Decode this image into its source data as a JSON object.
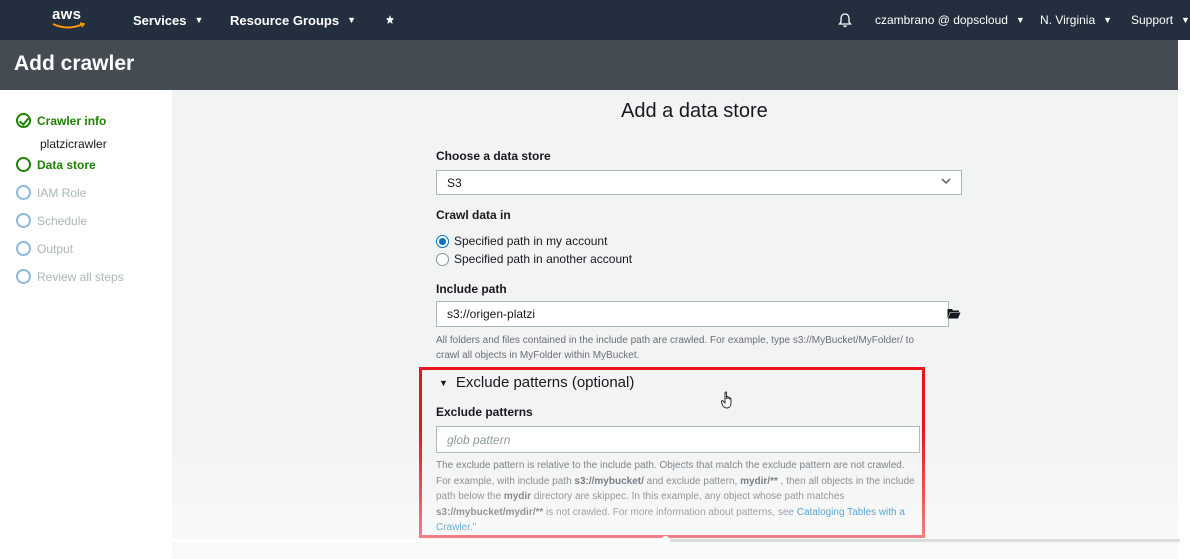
{
  "topnav": {
    "logo": "aws",
    "services": "Services",
    "resource_groups": "Resource Groups",
    "user": "czambrano @ dopscloud",
    "region": "N. Virginia",
    "support": "Support"
  },
  "header": {
    "title": "Add crawler"
  },
  "sidebar": {
    "steps": [
      {
        "label": "Crawler info",
        "state": "done"
      },
      {
        "label": "Data store",
        "state": "active"
      },
      {
        "label": "IAM Role",
        "state": "pending"
      },
      {
        "label": "Schedule",
        "state": "pending"
      },
      {
        "label": "Output",
        "state": "pending"
      },
      {
        "label": "Review all steps",
        "state": "pending"
      }
    ],
    "crawler_name": "platzicrawler"
  },
  "main": {
    "title": "Add a data store",
    "choose_label": "Choose a data store",
    "data_store_value": "S3",
    "crawl_label": "Crawl data in",
    "radio_options": [
      "Specified path in my account",
      "Specified path in another account"
    ],
    "radio_selected_index": 0,
    "include_label": "Include path",
    "include_value": "s3://origen-platzi",
    "include_help_1": "All folders and files contained in the include path are crawled. For example, type s3://MyBucket/MyFolder/ to",
    "include_help_2": "crawl all objects in MyFolder within MyBucket.",
    "exclude_section_title": "Exclude patterns (optional)",
    "exclude_label": "Exclude patterns",
    "exclude_placeholder": "glob pattern",
    "exclude_help": {
      "p1": "The exclude pattern is relative to the include path. Objects that match the exclude pattern are not crawled. For example, with include path ",
      "b1": "s3://mybucket/",
      "p2": " and exclude pattern, ",
      "b2": "mydir/**",
      "p3": " , then all objects in the include path below the ",
      "b3": "mydir",
      "p4": " directory are skippec. In this example, any object whose path matches ",
      "b4": "s3://mybucket/mydir/**",
      "p5": " is not crawled. For more information about patterns, see ",
      "link": "Cataloging Tables with a Crawler",
      "p6": ".\""
    }
  },
  "video": {
    "progress": 0.56
  },
  "colors": {
    "nav_bg": "#232f3e",
    "header_bg": "#444b53",
    "success": "#1d8102",
    "highlight": "#e8151d",
    "link": "#0073bb"
  },
  "icons": [
    "notification-bell-icon",
    "pin-icon",
    "folder-open-icon",
    "hand-pointer-icon",
    "checkmark-circle-icon"
  ]
}
